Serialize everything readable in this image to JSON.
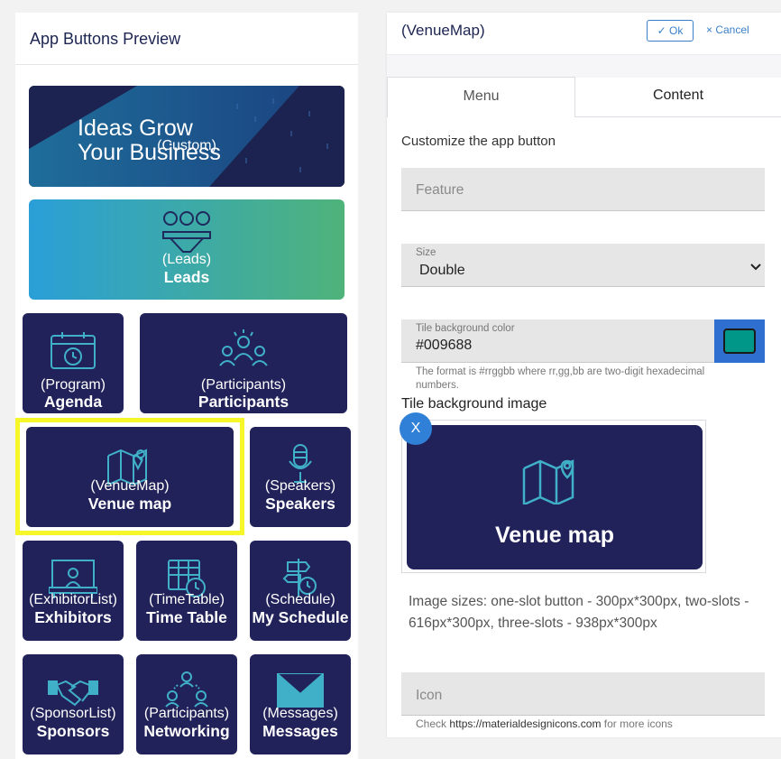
{
  "left": {
    "title": "App Buttons Preview",
    "tiles": [
      {
        "label": "(Custom)",
        "banner_line1": "Ideas Grow",
        "banner_line2": "Your Business"
      },
      {
        "label": "(Leads)",
        "name": "Leads"
      },
      {
        "label": "(Program)",
        "name": "Agenda"
      },
      {
        "label": "(Participants)",
        "name": "Participants"
      },
      {
        "label": "(VenueMap)",
        "name": "Venue map"
      },
      {
        "label": "(Speakers)",
        "name": "Speakers"
      },
      {
        "label": "(ExhibitorList)",
        "name": "Exhibitors"
      },
      {
        "label": "(TimeTable)",
        "name": "Time Table"
      },
      {
        "label": "(Schedule)",
        "name": "My Schedule"
      },
      {
        "label": "(SponsorList)",
        "name": "Sponsors"
      },
      {
        "label": "(Participants)",
        "name": "Networking"
      },
      {
        "label": "(Messages)",
        "name": "Messages"
      }
    ]
  },
  "right": {
    "title": "(VenueMap)",
    "ok_label": "✓ Ok",
    "cancel_label": "× Cancel",
    "tabs": [
      {
        "label": "Menu"
      },
      {
        "label": "Content"
      }
    ],
    "subtitle": "Customize the app button",
    "feature_placeholder": "Feature",
    "size_label": "Size",
    "size_value": "Double",
    "bg_color_label": "Tile background color",
    "bg_color_value": "#009688",
    "bg_color_hint": "The format is #rrggbb where rr,gg,bb are two-digit hexadecimal numbers.",
    "bg_image_label": "Tile background image",
    "bg_image_tile_name": "Venue map",
    "remove_label": "X",
    "image_sizes": "Image sizes: one-slot button - 300px*300px, two-slots - 616px*300px, three-slots - 938px*300px",
    "icon_placeholder": "Icon",
    "check_prefix": "Check",
    "check_link": "https://materialdesignicons.com",
    "check_suffix": "for more icons"
  },
  "colors": {
    "tile_bg": "#22225a",
    "accent_gradient_start": "#2a9fd8",
    "accent_gradient_end": "#4fb37a",
    "icon_gradient": "#3fb0c8",
    "selection": "#f6f628",
    "primary_blue": "#2f80d6",
    "swatch": "#009688"
  },
  "icons": [
    "user-group-funnel-icon",
    "calendar-clock-icon",
    "presenter-group-icon",
    "map-pin-icon",
    "microphone-icon",
    "exhibitor-desk-icon",
    "timetable-icon",
    "signpost-clock-icon",
    "handshake-icon",
    "network-people-icon",
    "envelope-icon",
    "check-icon",
    "close-icon",
    "chevron-down-icon"
  ]
}
